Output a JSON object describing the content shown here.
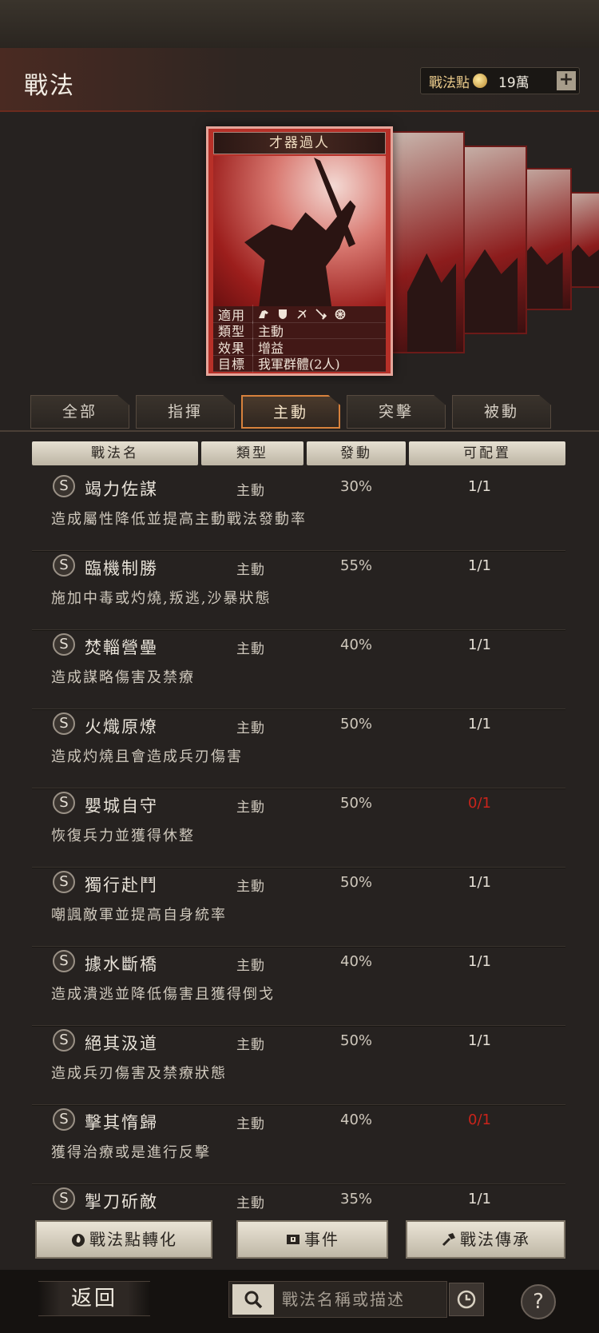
{
  "header": {
    "title": "戰法",
    "points_label": "戰法點",
    "points_value": "19萬",
    "plus_label": "+"
  },
  "card": {
    "title": "才器過人",
    "rows": [
      {
        "key": "適用",
        "value": ""
      },
      {
        "key": "類型",
        "value": "主動"
      },
      {
        "key": "效果",
        "value": "增益"
      },
      {
        "key": "目標",
        "value": "我軍群體(2人)"
      }
    ],
    "troop_icons": [
      "cavalry-icon",
      "shield-icon",
      "bow-icon",
      "spear-icon",
      "siege-icon"
    ]
  },
  "tabs": [
    {
      "label": "全部",
      "active": false
    },
    {
      "label": "指揮",
      "active": false
    },
    {
      "label": "主動",
      "active": true
    },
    {
      "label": "突擊",
      "active": false
    },
    {
      "label": "被動",
      "active": false
    }
  ],
  "columns": [
    "戰法名",
    "類型",
    "發動",
    "可配置"
  ],
  "skills": [
    {
      "grade": "S",
      "name": "竭力佐謀",
      "type": "主動",
      "rate": "30%",
      "slots": "1/1",
      "desc": "造成屬性降低並提高主動戰法發動率"
    },
    {
      "grade": "S",
      "name": "臨機制勝",
      "type": "主動",
      "rate": "55%",
      "slots": "1/1",
      "desc": "施加中毒或灼燒,叛逃,沙暴狀態"
    },
    {
      "grade": "S",
      "name": "焚輜營壘",
      "type": "主動",
      "rate": "40%",
      "slots": "1/1",
      "desc": "造成謀略傷害及禁療"
    },
    {
      "grade": "S",
      "name": "火熾原燎",
      "type": "主動",
      "rate": "50%",
      "slots": "1/1",
      "desc": "造成灼燒且會造成兵刃傷害"
    },
    {
      "grade": "S",
      "name": "嬰城自守",
      "type": "主動",
      "rate": "50%",
      "slots": "0/1",
      "desc": "恢復兵力並獲得休整"
    },
    {
      "grade": "S",
      "name": "獨行赴鬥",
      "type": "主動",
      "rate": "50%",
      "slots": "1/1",
      "desc": "嘲諷敵軍並提高自身統率"
    },
    {
      "grade": "S",
      "name": "據水斷橋",
      "type": "主動",
      "rate": "40%",
      "slots": "1/1",
      "desc": "造成潰逃並降低傷害且獲得倒戈"
    },
    {
      "grade": "S",
      "name": "絕其汲道",
      "type": "主動",
      "rate": "50%",
      "slots": "1/1",
      "desc": "造成兵刃傷害及禁療狀態"
    },
    {
      "grade": "S",
      "name": "擊其惰歸",
      "type": "主動",
      "rate": "40%",
      "slots": "0/1",
      "desc": "獲得治療或是進行反擊"
    },
    {
      "grade": "S",
      "name": "掣刀斫敵",
      "type": "主動",
      "rate": "35%",
      "slots": "1/1",
      "desc": ""
    }
  ],
  "buttons": {
    "convert": "戰法點轉化",
    "events": "事件",
    "inherit": "戰法傳承"
  },
  "footer": {
    "back": "返回",
    "search_placeholder": "戰法名稱或描述",
    "help": "?"
  },
  "colors": {
    "accent": "#d7813c",
    "unavailable": "#c9241b",
    "card_red": "#b73028"
  }
}
